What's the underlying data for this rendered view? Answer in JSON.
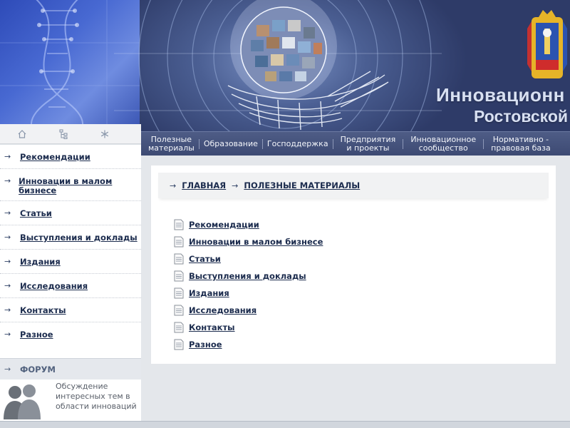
{
  "header": {
    "title_line1": "Инновационн",
    "title_line2": "Ростовской"
  },
  "icon_strip": [
    "home-icon",
    "sitemap-icon",
    "asterisk-icon"
  ],
  "nav": {
    "items": [
      {
        "line1": "Полезные",
        "line2": "материалы"
      },
      {
        "line1": "Образование",
        "line2": ""
      },
      {
        "line1": "Господдержка",
        "line2": ""
      },
      {
        "line1": "Предприятия",
        "line2": "и проекты"
      },
      {
        "line1": "Инновационное",
        "line2": "сообщество"
      },
      {
        "line1": "Нормативно -",
        "line2": "правовая база"
      }
    ]
  },
  "sidebar": {
    "items": [
      "Рекомендации",
      "Инновации в малом бизнесе",
      "Статьи",
      "Выступления и доклады",
      "Издания",
      "Исследования",
      "Контакты",
      "Разное"
    ],
    "forum": {
      "label": "ФОРУМ",
      "description": "Обсуждение интересных тем в области инноваций"
    }
  },
  "breadcrumb": [
    "ГЛАВНАЯ",
    "ПОЛЕЗНЫЕ МАТЕРИАЛЫ"
  ],
  "documents": [
    "Рекомендации",
    "Инновации в малом бизнесе",
    "Статьи",
    "Выступления и доклады",
    "Издания",
    "Исследования",
    "Контакты",
    "Разное"
  ],
  "colors": {
    "nav_bg": "#3d4a73",
    "link": "#1c2c4e",
    "header_title": "#d8e0f2"
  }
}
